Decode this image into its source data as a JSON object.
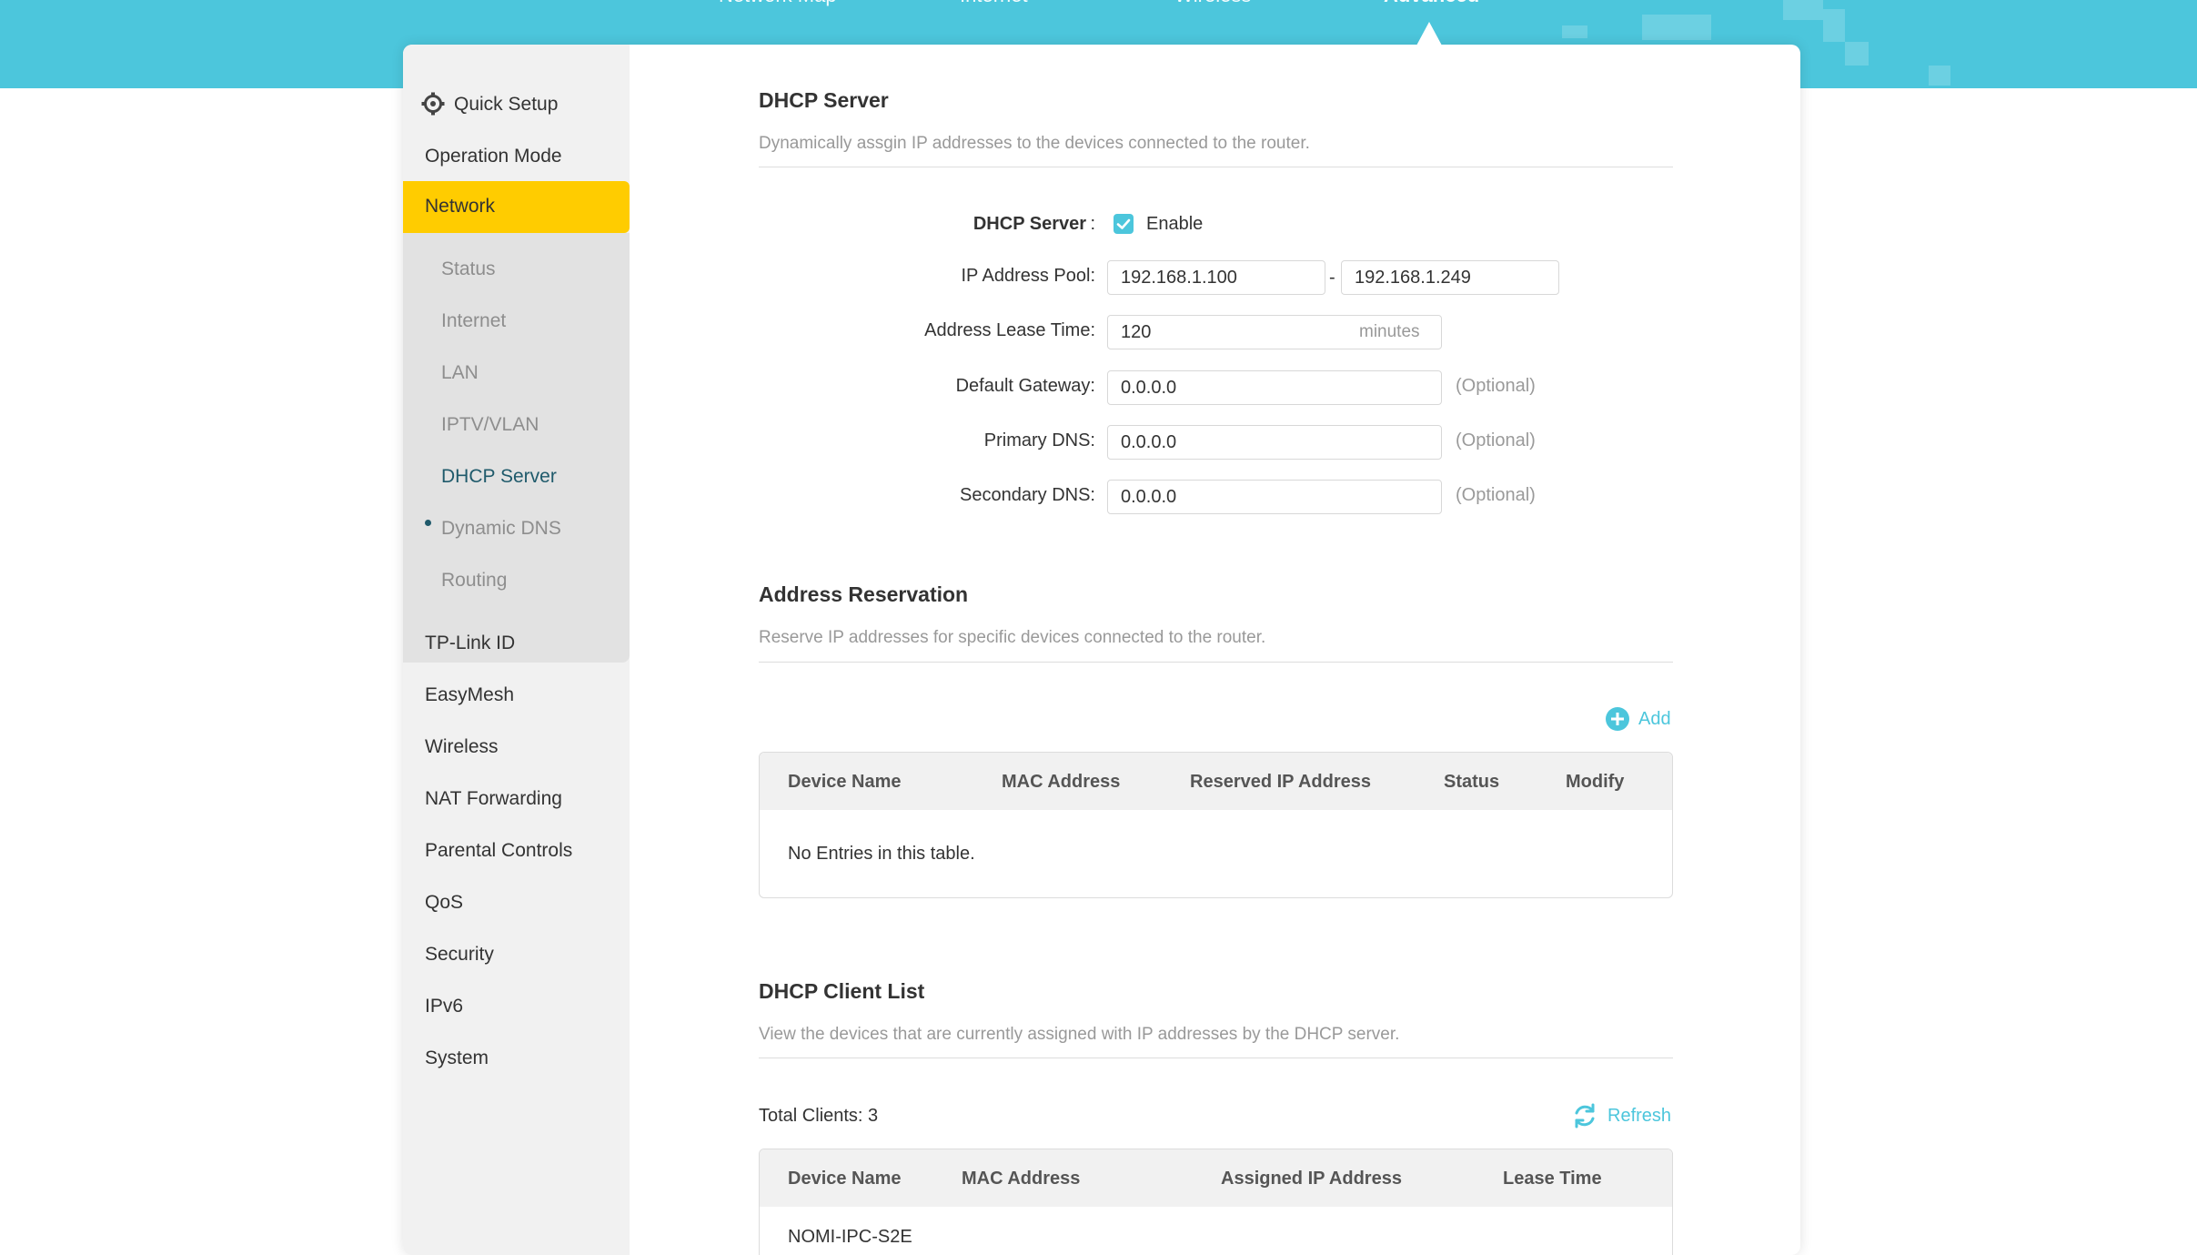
{
  "top_nav": {
    "tabs": [
      {
        "label": "Network Map"
      },
      {
        "label": "Internet"
      },
      {
        "label": "Wireless"
      },
      {
        "label": "Advanced"
      }
    ]
  },
  "sidebar": {
    "items": [
      {
        "label": "Quick Setup"
      },
      {
        "label": "Operation Mode"
      },
      {
        "label": "Network"
      }
    ],
    "network_sub": [
      {
        "label": "Status"
      },
      {
        "label": "Internet"
      },
      {
        "label": "LAN"
      },
      {
        "label": "IPTV/VLAN"
      },
      {
        "label": "DHCP Server"
      },
      {
        "label": "Dynamic DNS"
      },
      {
        "label": "Routing"
      }
    ],
    "more_items": [
      {
        "label": "TP-Link ID"
      },
      {
        "label": "EasyMesh"
      },
      {
        "label": "Wireless"
      },
      {
        "label": "NAT Forwarding"
      },
      {
        "label": "Parental Controls"
      },
      {
        "label": "QoS"
      },
      {
        "label": "Security"
      },
      {
        "label": "IPv6"
      },
      {
        "label": "System"
      }
    ]
  },
  "dhcp_server": {
    "title": "DHCP Server",
    "desc": "Dynamically assgin IP addresses to the devices connected to the router.",
    "server_label": "DHCP Server",
    "colon": ":",
    "enable_label": "Enable",
    "pool_label": "IP Address Pool:",
    "pool_start": "192.168.1.100",
    "pool_dash": "-",
    "pool_end": "192.168.1.249",
    "lease_label": "Address Lease Time:",
    "lease_value": "120",
    "lease_unit": "minutes",
    "gateway_label": "Default Gateway:",
    "gateway_value": "0.0.0.0",
    "primary_dns_label": "Primary DNS:",
    "primary_dns_value": "0.0.0.0",
    "secondary_dns_label": "Secondary DNS:",
    "secondary_dns_value": "0.0.0.0",
    "optional": "(Optional)"
  },
  "reservation": {
    "title": "Address Reservation",
    "desc": "Reserve IP addresses for specific devices connected to the router.",
    "add_label": "Add",
    "columns": [
      "Device Name",
      "MAC Address",
      "Reserved IP Address",
      "Status",
      "Modify"
    ],
    "empty_text": "No Entries in this table."
  },
  "client_list": {
    "title": "DHCP Client List",
    "desc": "View the devices that are currently assigned with IP addresses by the DHCP server.",
    "total_label": "Total Clients: 3",
    "refresh_label": "Refresh",
    "columns": [
      "Device Name",
      "MAC Address",
      "Assigned IP Address",
      "Lease Time"
    ],
    "first_row_name": "NOMI-IPC-S2E"
  },
  "colors": {
    "accent": "#4cc6dc",
    "highlight": "#ffcc00",
    "sidebar_bg": "#f1f1f1",
    "subnav_bg": "#e2e2e2"
  }
}
